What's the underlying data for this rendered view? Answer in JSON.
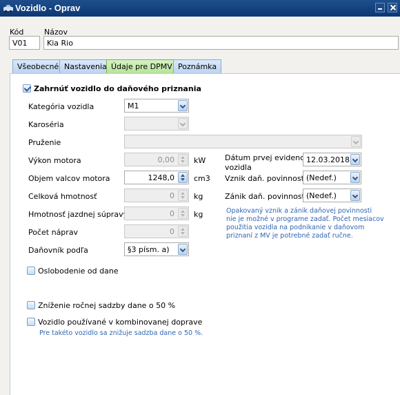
{
  "window": {
    "title": "Vozidlo - Oprav"
  },
  "header": {
    "code_label": "Kód",
    "code_value": "V01",
    "name_label": "Názov",
    "name_value": "Kia Rio"
  },
  "tabs": [
    "Všeobecné",
    "Nastavenia",
    "Údaje pre DPMV",
    "Poznámka"
  ],
  "active_tab": "Údaje pre DPMV",
  "include_tax_return": {
    "label": "Zahrnúť vozidlo do daňového priznania",
    "checked": true
  },
  "fields": {
    "category": {
      "label": "Kategória vozidla",
      "value": "M1"
    },
    "body": {
      "label": "Karoséria",
      "value": ""
    },
    "suspension": {
      "label": "Pruženie",
      "value": ""
    },
    "power": {
      "label": "Výkon motora",
      "value": "0,00",
      "unit": "kW"
    },
    "displacement": {
      "label": "Objem valcov motora",
      "value": "1248,0",
      "unit": "cm3"
    },
    "total_weight": {
      "label": "Celková hmotnosť",
      "value": "0",
      "unit": "kg"
    },
    "combo_weight": {
      "label": "Hmotnosť jazdnej súpravy",
      "value": "0",
      "unit": "kg"
    },
    "axles": {
      "label": "Počet náprav",
      "value": "0"
    },
    "taxpayer_by": {
      "label": "Daňovník podľa",
      "value": "§3 písm. a)"
    }
  },
  "right": {
    "first_registration_label_1": "Dátum prvej evidencie",
    "first_registration_label_2": "vozidla",
    "first_registration_value": "12.03.2018",
    "liability_start_label": "Vznik daň. povinnosti",
    "liability_start_value": "(Nedef.)",
    "liability_end_label": "Zánik daň. povinnosti",
    "liability_end_value": "(Nedef.)",
    "note_lines": [
      "Opakovaný vznik a zánik daňovej povinnosti",
      "nie je možné v programe zadať. Počet mesiacov",
      "použitia vozidla na podnikanie v daňovom",
      "priznaní z MV je potrebné zadať ručne."
    ]
  },
  "exempt": {
    "label": "Oslobodenie od dane",
    "checked": false
  },
  "reduction": {
    "label": "Zníženie ročnej sadzby dane o 50 %",
    "checked": false
  },
  "combined": {
    "label": "Vozidlo používané v kombinovanej doprave",
    "checked": false
  },
  "combined_note": "Pre takéto vozidlo sa znižuje sadzba dane o 50 %."
}
